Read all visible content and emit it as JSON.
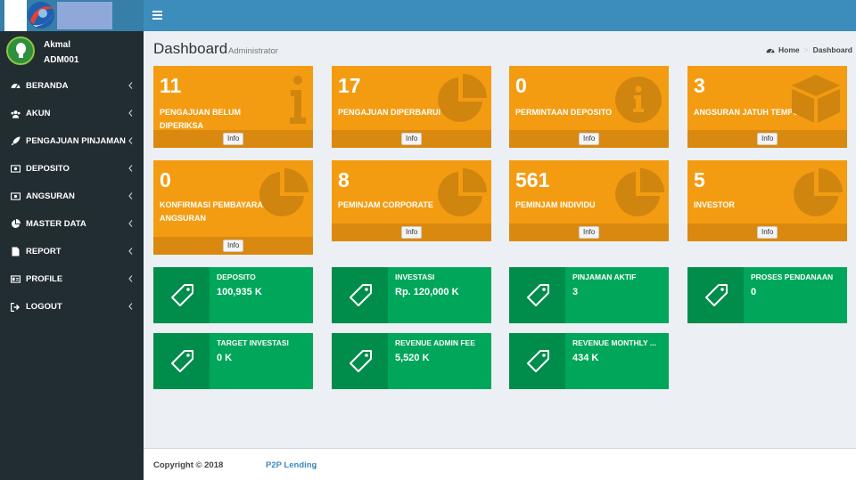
{
  "user": {
    "name": "Akmal",
    "id": "ADM001"
  },
  "menu": [
    {
      "label": "BERANDA",
      "icon": "dashboard-icon"
    },
    {
      "label": "AKUN",
      "icon": "users-icon"
    },
    {
      "label": "PENGAJUAN PINJAMAN",
      "icon": "rocket-icon"
    },
    {
      "label": "DEPOSITO",
      "icon": "money-icon"
    },
    {
      "label": "ANGSURAN",
      "icon": "money-icon"
    },
    {
      "label": "MASTER DATA",
      "icon": "pie-chart-icon"
    },
    {
      "label": "REPORT",
      "icon": "file-icon"
    },
    {
      "label": "PROFILE",
      "icon": "id-card-icon"
    },
    {
      "label": "LOGOUT",
      "icon": "sign-out-icon"
    }
  ],
  "header": {
    "title": "Dashboard",
    "subtitle": "Administrator",
    "breadcrumb": {
      "home": "Home",
      "current": "Dashboard"
    }
  },
  "tiles": [
    {
      "value": "11",
      "label": "PENGAJUAN BELUM DIPERIKSA",
      "icon": "info-letter-icon",
      "info": "Info"
    },
    {
      "value": "17",
      "label": "PENGAJUAN DIPERBARUI",
      "icon": "pie-chart-icon",
      "info": "Info"
    },
    {
      "value": "0",
      "label": "PERMINTAAN DEPOSITO",
      "icon": "info-circle-icon",
      "info": "Info"
    },
    {
      "value": "3",
      "label": "ANGSURAN JATUH TEMPO",
      "icon": "cube-icon",
      "info": "Info"
    },
    {
      "value": "0",
      "label": "KONFIRMASI PEMBAYARAN ANGSURAN",
      "icon": "pie-chart-icon",
      "info": "Info"
    },
    {
      "value": "8",
      "label": "PEMINJAM CORPORATE",
      "icon": "pie-chart-icon",
      "info": "Info"
    },
    {
      "value": "561",
      "label": "PEMINJAM INDIVIDU",
      "icon": "pie-chart-icon",
      "info": "Info"
    },
    {
      "value": "5",
      "label": "INVESTOR",
      "icon": "pie-chart-icon",
      "info": "Info"
    }
  ],
  "stats": [
    {
      "label": "DEPOSITO",
      "value": "100,935 K",
      "icon": "tag-icon"
    },
    {
      "label": "INVESTASI",
      "value": "Rp. 120,000 K",
      "icon": "tag-icon"
    },
    {
      "label": "PINJAMAN AKTIF",
      "value": "3",
      "icon": "tag-icon"
    },
    {
      "label": "PROSES PENDANAAN",
      "value": "0",
      "icon": "tag-icon"
    },
    {
      "label": "TARGET INVESTASI",
      "value": "0 K",
      "icon": "tag-icon"
    },
    {
      "label": "REVENUE ADMIN FEE",
      "value": "5,520 K",
      "icon": "tag-icon"
    },
    {
      "label": "REVENUE MONTHLY ...",
      "value": "434 K",
      "icon": "tag-icon"
    }
  ],
  "footer": {
    "copyright": "Copyright © 2018",
    "brand": "P2P Lending",
    "suffix": "."
  },
  "colors": {
    "topbar": "#3c8dbc",
    "sidebar": "#222d32",
    "tile": "#f39c12",
    "stat": "#00a65a"
  }
}
